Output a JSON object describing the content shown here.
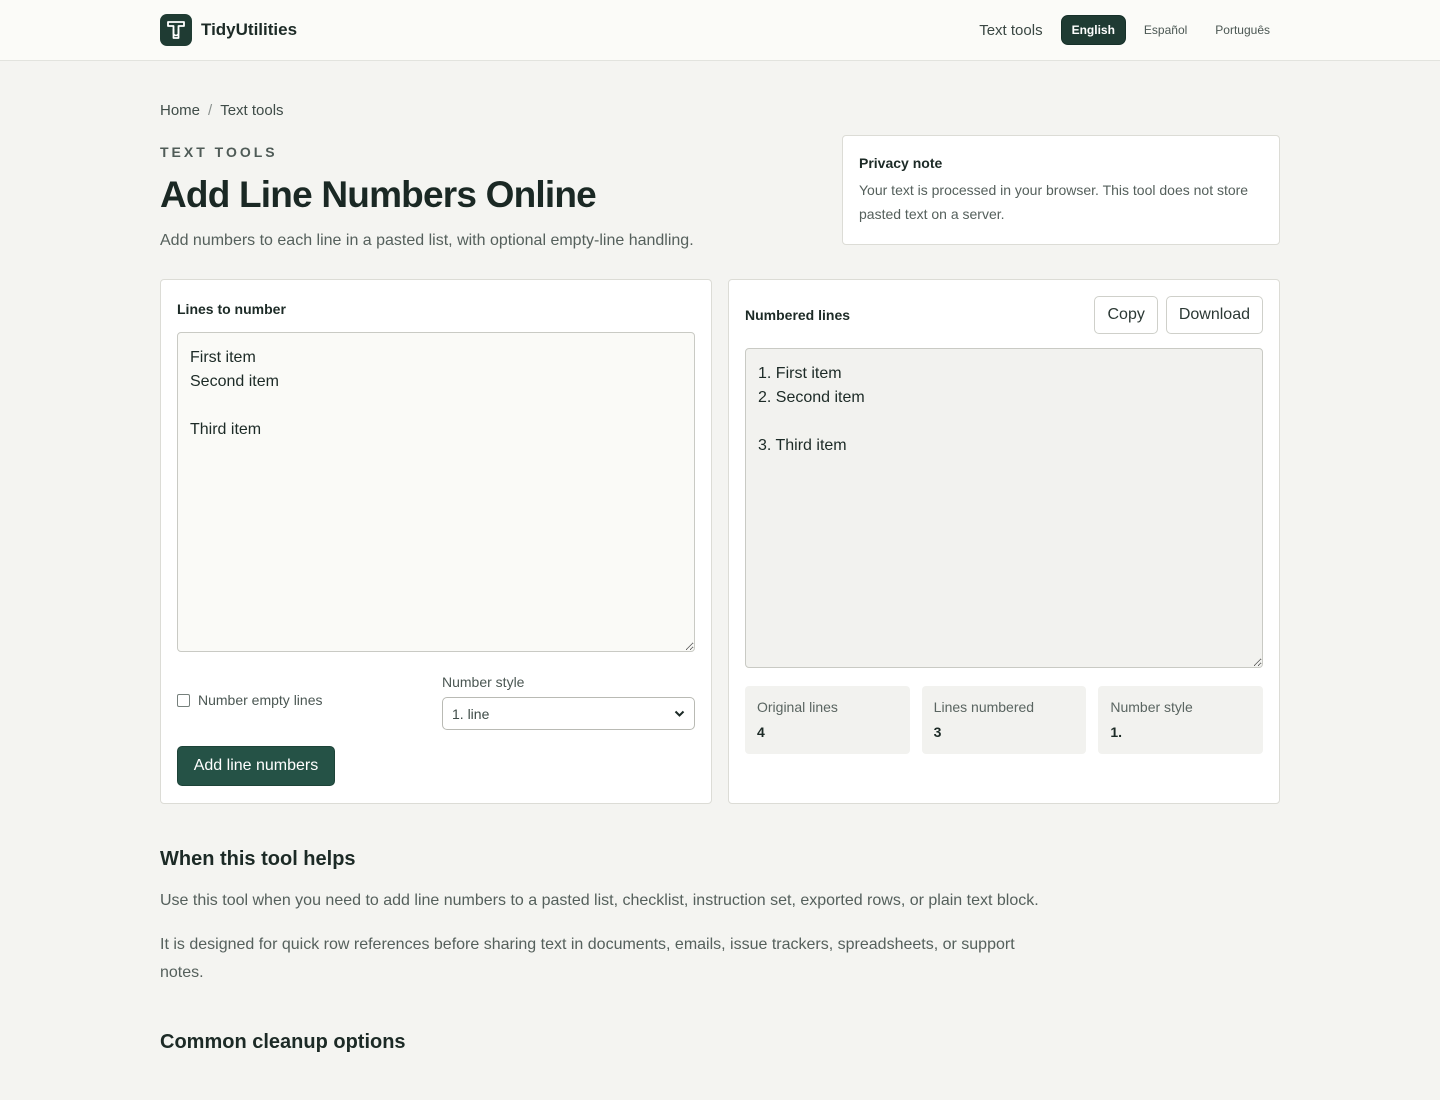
{
  "header": {
    "brand": "TidyUtilities",
    "nav_text_tools": "Text tools",
    "languages": [
      "English",
      "Español",
      "Português"
    ]
  },
  "breadcrumb": {
    "home": "Home",
    "separator": "/",
    "current": "Text tools"
  },
  "hero": {
    "eyebrow": "TEXT TOOLS",
    "title": "Add Line Numbers Online",
    "subtitle": "Add numbers to each line in a pasted list, with optional empty-line handling."
  },
  "privacy": {
    "title": "Privacy note",
    "text": "Your text is processed in your browser. This tool does not store pasted text on a server."
  },
  "input_panel": {
    "label": "Lines to number",
    "value": "First item\nSecond item\n\nThird item",
    "checkbox_label": "Number empty lines",
    "checkbox_checked": false,
    "style_label": "Number style",
    "style_selected": "1. line",
    "submit_label": "Add line numbers"
  },
  "output_panel": {
    "label": "Numbered lines",
    "copy_label": "Copy",
    "download_label": "Download",
    "value": "1. First item\n2. Second item\n\n3. Third item",
    "stats": [
      {
        "label": "Original lines",
        "value": "4"
      },
      {
        "label": "Lines numbered",
        "value": "3"
      },
      {
        "label": "Number style",
        "value": "1."
      }
    ]
  },
  "content": {
    "helps_title": "When this tool helps",
    "helps_p1": "Use this tool when you need to add line numbers to a pasted list, checklist, instruction set, exported rows, or plain text block.",
    "helps_p2": "It is designed for quick row references before sharing text in documents, emails, issue trackers, spreadsheets, or support notes.",
    "cleanup_title": "Common cleanup options"
  },
  "colors": {
    "accent": "#255246",
    "brand_dark": "#1f3b33",
    "background": "#f4f4f1"
  }
}
